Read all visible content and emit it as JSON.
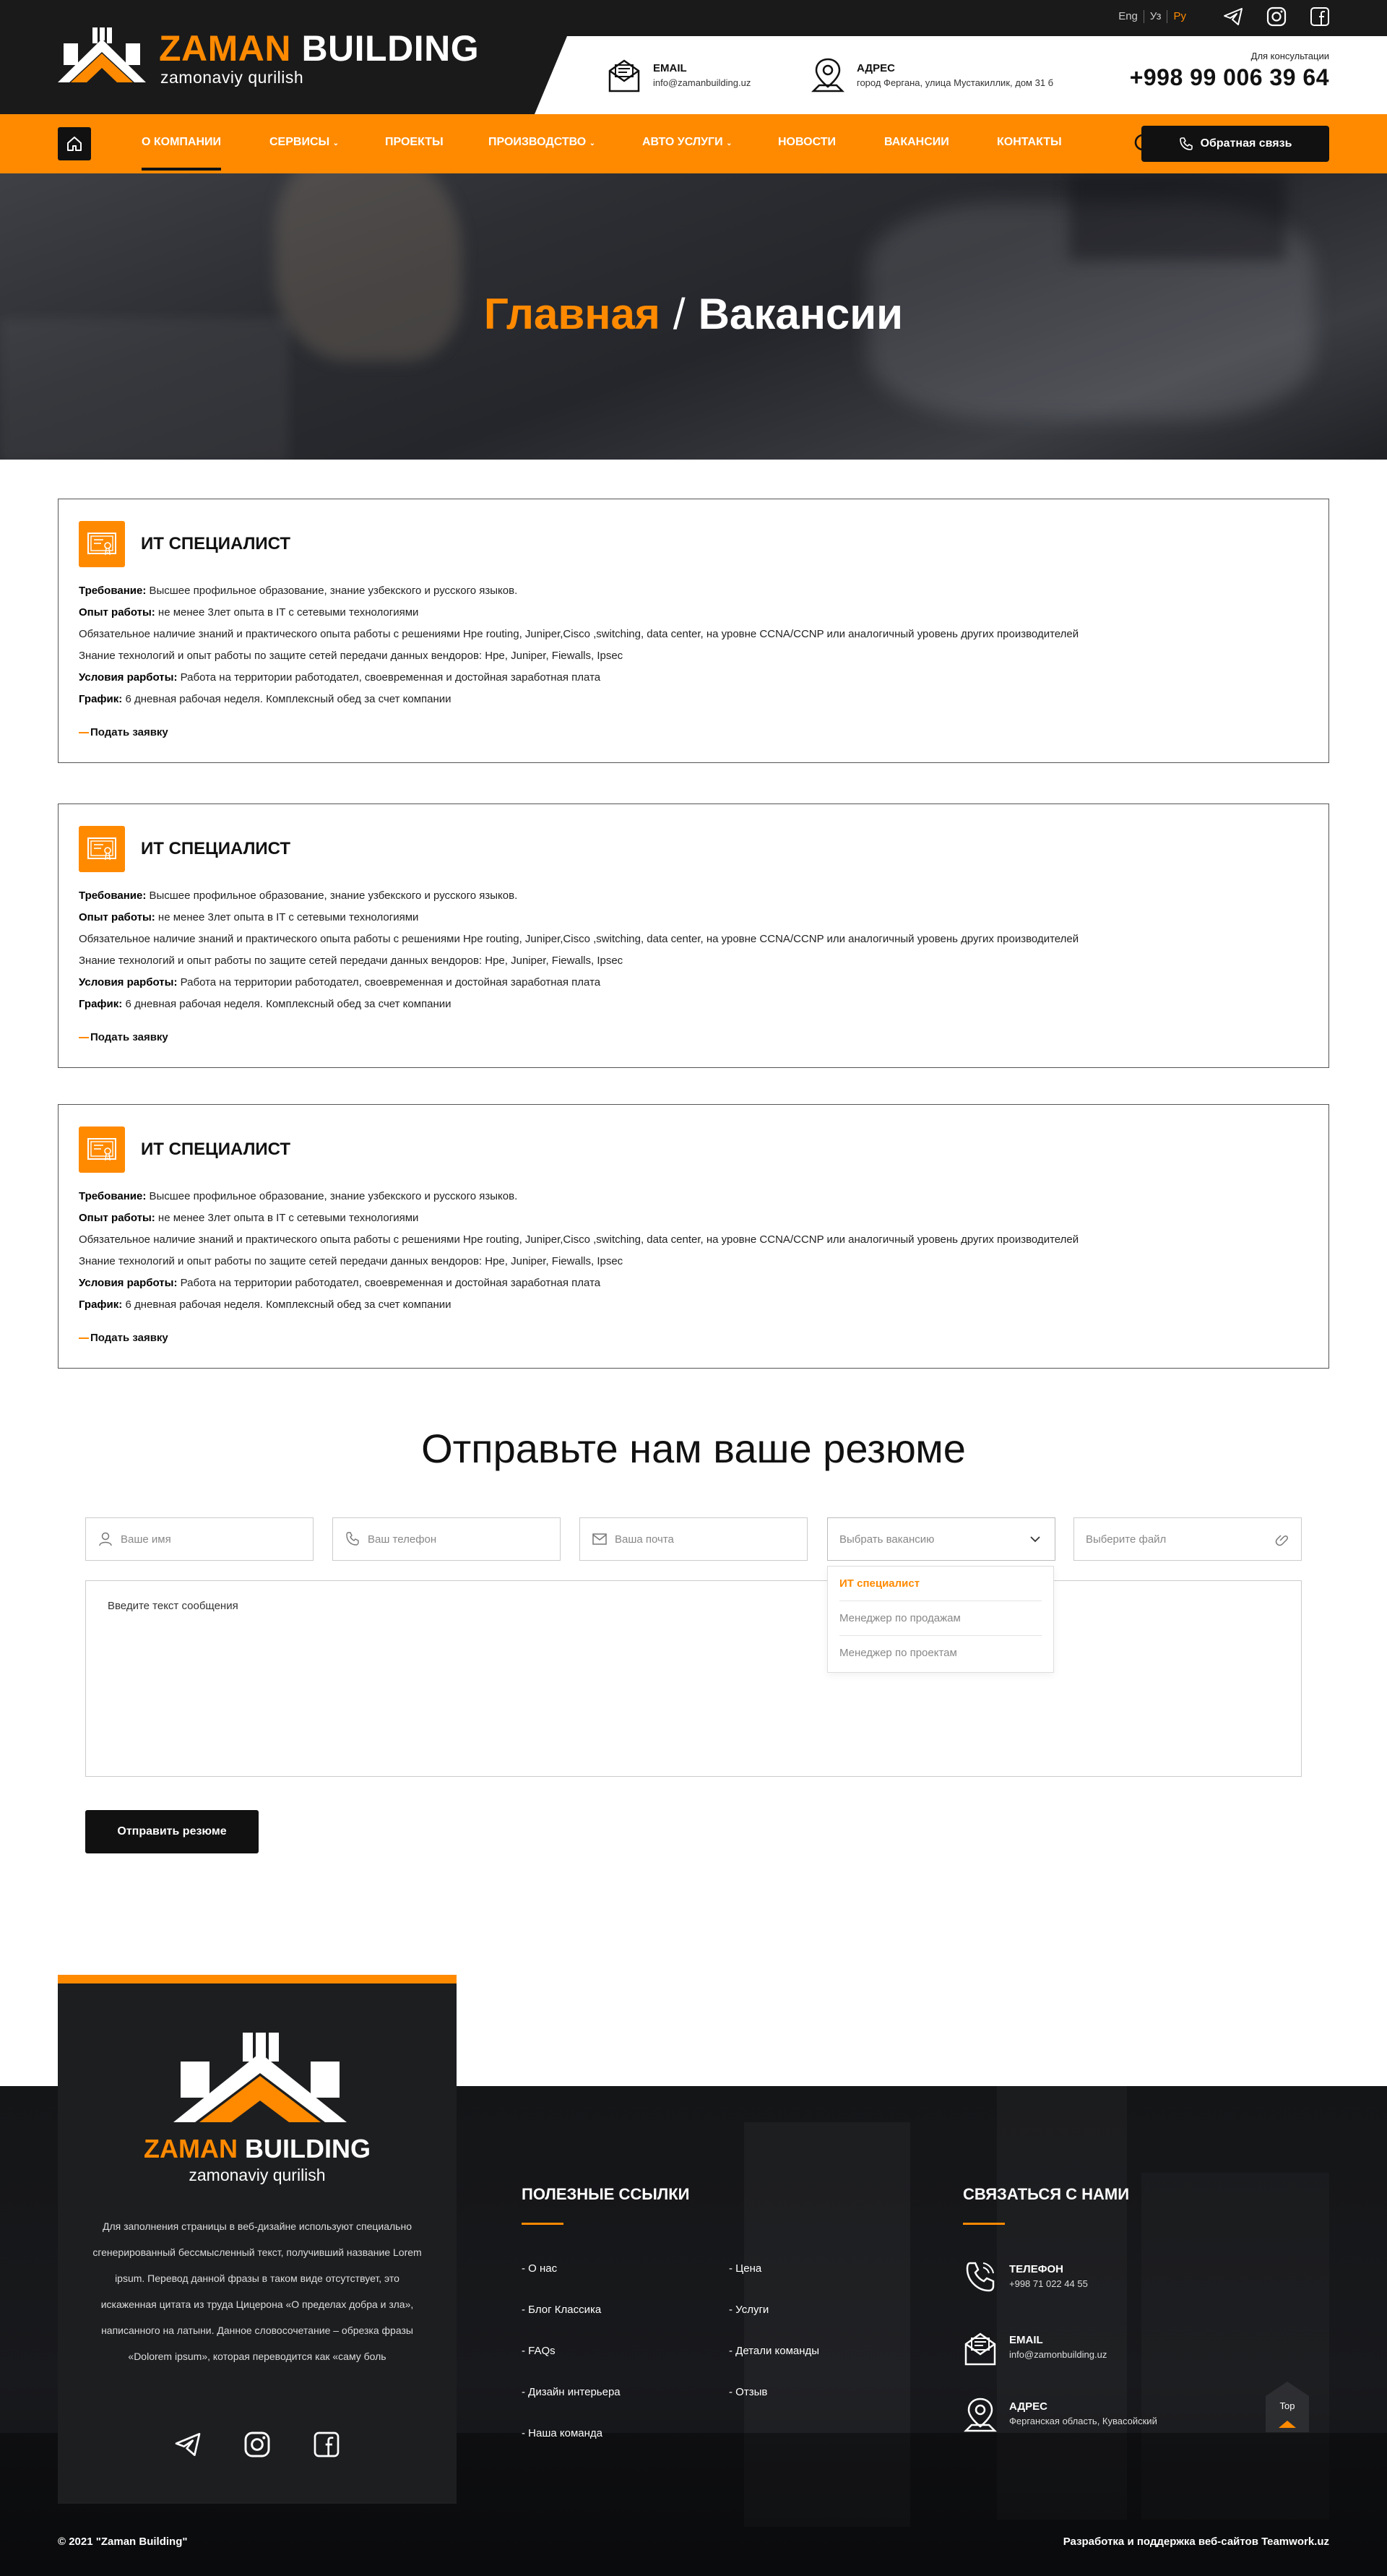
{
  "brand": {
    "name_part1": "ZAMAN",
    "name_part2": "BUILDING",
    "tagline": "zamonaviy qurilish",
    "accent_color": "#ff8a00",
    "dark_color": "#111111"
  },
  "header": {
    "languages": [
      {
        "label": "Eng",
        "active": false
      },
      {
        "label": "Уз",
        "active": false
      },
      {
        "label": "Ру",
        "active": true
      }
    ],
    "socials": [
      "telegram-icon",
      "instagram-icon",
      "facebook-icon"
    ],
    "email": {
      "label": "EMAIL",
      "value": "info@zamanbuilding.uz"
    },
    "address": {
      "label": "АДРЕС",
      "value": "город Фергана, улица Мустакиллик, дом 31 б"
    },
    "phone": {
      "caption": "Для консультации",
      "number": "+998 99 006 39 64"
    }
  },
  "nav": {
    "items": [
      {
        "label": "О компании",
        "has_dropdown": false,
        "active": true
      },
      {
        "label": "Сервисы",
        "has_dropdown": true,
        "active": false
      },
      {
        "label": "Проекты",
        "has_dropdown": false,
        "active": false
      },
      {
        "label": "Производство",
        "has_dropdown": true,
        "active": false
      },
      {
        "label": "Авто услуги",
        "has_dropdown": true,
        "active": false
      },
      {
        "label": "Новости",
        "has_dropdown": false,
        "active": false
      },
      {
        "label": "Вакансии",
        "has_dropdown": false,
        "active": false
      },
      {
        "label": "Контакты",
        "has_dropdown": false,
        "active": false
      }
    ],
    "callback_label": "Обратная связь"
  },
  "hero": {
    "breadcrumb_home": "Главная",
    "separator": "/",
    "breadcrumb_current": "Вакансии"
  },
  "vacancies": [
    {
      "title": "ИТ СПЕЦИАЛИСТ",
      "lines": [
        {
          "key": "Требование:",
          "text": " Высшее профильное образование, знание узбекского и русского языков."
        },
        {
          "key": "Опыт работы:",
          "text": " не менее 3лет опыта в IT с сетевыми технологиями"
        },
        {
          "key": "",
          "text": "Обязательное наличие знаний и практического опыта работы с решениями Hpe routing, Juniper,Cisco ,switching, data center, на уровне CCNA/CCNP или аналогичный уровень других производителей"
        },
        {
          "key": "",
          "text": "Знание технологий и опыт работы по защите сетей передачи данных вендоров: Hpe, Juniper, Fiewalls, Ipsec"
        },
        {
          "key": "Условия рарботы:",
          "text": " Работа на территории работодател, своевременная и достойная заработная плата"
        },
        {
          "key": "График:",
          "text": " 6 дневная рабочая неделя. Комплексный обед за счет компании"
        }
      ],
      "apply_label": "Подать заявку"
    },
    {
      "title": "ИТ СПЕЦИАЛИСТ",
      "lines": [
        {
          "key": "Требование:",
          "text": " Высшее профильное образование, знание узбекского и русского языков."
        },
        {
          "key": "Опыт работы:",
          "text": " не менее 3лет опыта в IT с сетевыми технологиями"
        },
        {
          "key": "",
          "text": "Обязательное наличие знаний и практического опыта работы с решениями Hpe routing, Juniper,Cisco ,switching, data center, на уровне CCNA/CCNP или аналогичный уровень других производителей"
        },
        {
          "key": "",
          "text": "Знание технологий и опыт работы по защите сетей передачи данных вендоров: Hpe, Juniper, Fiewalls, Ipsec"
        },
        {
          "key": "Условия рарботы:",
          "text": " Работа на территории работодател, своевременная и достойная заработная плата"
        },
        {
          "key": "График:",
          "text": " 6 дневная рабочая неделя. Комплексный обед за счет компании"
        }
      ],
      "apply_label": "Подать заявку"
    },
    {
      "title": "ИТ СПЕЦИАЛИСТ",
      "lines": [
        {
          "key": "Требование:",
          "text": " Высшее профильное образование, знание узбекского и русского языков."
        },
        {
          "key": "Опыт работы:",
          "text": " не менее 3лет опыта в IT с сетевыми технологиями"
        },
        {
          "key": "",
          "text": "Обязательное наличие знаний и практического опыта работы с решениями Hpe routing, Juniper,Cisco ,switching, data center, на уровне CCNA/CCNP или аналогичный уровень других производителей"
        },
        {
          "key": "",
          "text": "Знание технологий и опыт работы по защите сетей передачи данных вендоров: Hpe, Juniper, Fiewalls, Ipsec"
        },
        {
          "key": "Условия рарботы:",
          "text": " Работа на территории работодател, своевременная и достойная заработная плата"
        },
        {
          "key": "График:",
          "text": " 6 дневная рабочая неделя. Комплексный обед за счет компании"
        }
      ],
      "apply_label": "Подать заявку"
    }
  ],
  "resume_form": {
    "title": "Отправьте нам ваше резюме",
    "name_placeholder": "Ваше имя",
    "phone_placeholder": "Ваш телефон",
    "email_placeholder": "Ваша почта",
    "vacancy_placeholder": "Выбрать вакансию",
    "file_placeholder": "Выберите файл",
    "vacancy_options": [
      {
        "label": "ИТ специалист",
        "selected": true
      },
      {
        "label": "Менеджер по продажам",
        "selected": false
      },
      {
        "label": "Менеджер по проектам",
        "selected": false
      }
    ],
    "message_placeholder": "Введите текст сообщения",
    "submit_label": "Отправить резюме"
  },
  "footer": {
    "description": "Для заполнения страницы в веб-дизайне используют специально сгенерированный бессмысленный текст, получивший название Lorem ipsum. Перевод данной фразы в таком виде отсутствует, это искаженная цитата из труда Цицерона «О пределах добра и зла», написанного на латыни. Данное словосочетание – обрезка фразы «Dolorem ipsum», которая переводится как «саму боль",
    "useful_links_title": "Полезные ссылки",
    "links_col1": [
      "- О нас",
      "- Блог Классика",
      "- FAQs",
      "- Дизайн интерьера",
      "- Наша команда"
    ],
    "links_col2": [
      "- Цена",
      "- Услуги",
      "- Детали команды",
      "- Отзыв"
    ],
    "contact_title": "Связаться с нами",
    "contacts": [
      {
        "icon": "phone-icon",
        "label": "ТЕЛЕФОН",
        "value": "+998 71 022 44 55"
      },
      {
        "icon": "envelope-icon",
        "label": "EMAIL",
        "value": "info@zamonbuilding.uz"
      },
      {
        "icon": "map-pin-icon",
        "label": "АДРЕС",
        "value": "Ферганская область, Кувасойский"
      }
    ],
    "top_label": "Top",
    "copyright": "© 2021 \"Zaman Building\"",
    "developer": "Разработка и поддержка веб-сайтов Teamwork.uz"
  }
}
